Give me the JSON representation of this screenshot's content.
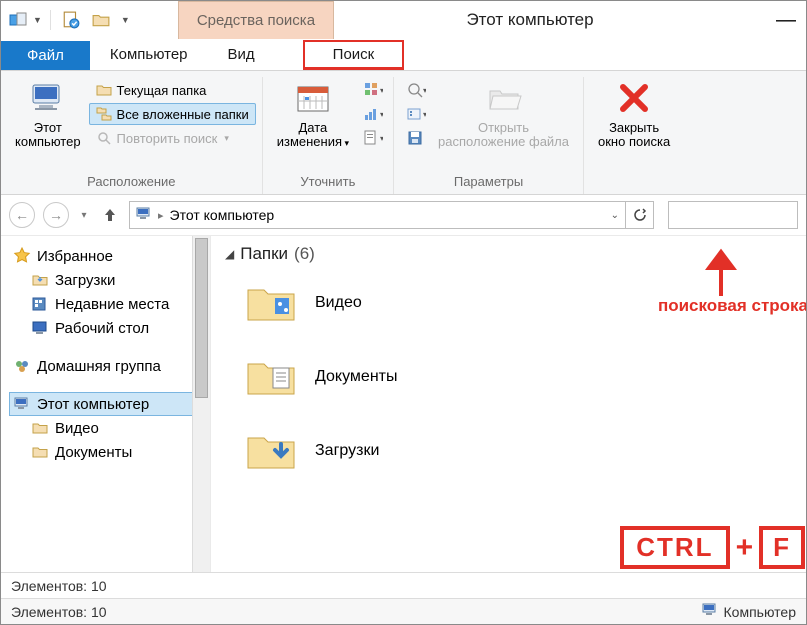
{
  "titlebar": {
    "context_tab": "Средства поиска",
    "window_title": "Этот компьютер"
  },
  "tabs": {
    "file": "Файл",
    "computer": "Компьютер",
    "view": "Вид",
    "search": "Поиск"
  },
  "ribbon": {
    "this_pc": {
      "line1": "Этот",
      "line2": "компьютер"
    },
    "current_folder": "Текущая папка",
    "all_subfolders": "Все вложенные папки",
    "repeat_search": "Повторить поиск",
    "location_group": "Расположение",
    "date": {
      "line1": "Дата",
      "line2": "изменения"
    },
    "refine_group": "Уточнить",
    "open": {
      "line1": "Открыть",
      "line2": "расположение файла"
    },
    "options_group": "Параметры",
    "close": {
      "line1": "Закрыть",
      "line2": "окно поиска"
    }
  },
  "address": {
    "path": "Этот компьютер"
  },
  "tree": {
    "favorites": "Избранное",
    "downloads": "Загрузки",
    "recent": "Недавние места",
    "desktop": "Рабочий стол",
    "homegroup": "Домашняя группа",
    "this_pc": "Этот компьютер",
    "video": "Видео",
    "documents": "Документы"
  },
  "files": {
    "group_header_name": "Папки",
    "group_header_count": "(6)",
    "items": [
      {
        "label": "Видео"
      },
      {
        "label": "Документы"
      },
      {
        "label": "Загрузки"
      }
    ]
  },
  "status": {
    "line1": "Элементов: 10",
    "line2_left": "Элементов: 10",
    "line2_right": "Компьютер"
  },
  "annotations": {
    "search_line": "поисковая строка",
    "key_ctrl": "CTRL",
    "key_f": "F"
  }
}
